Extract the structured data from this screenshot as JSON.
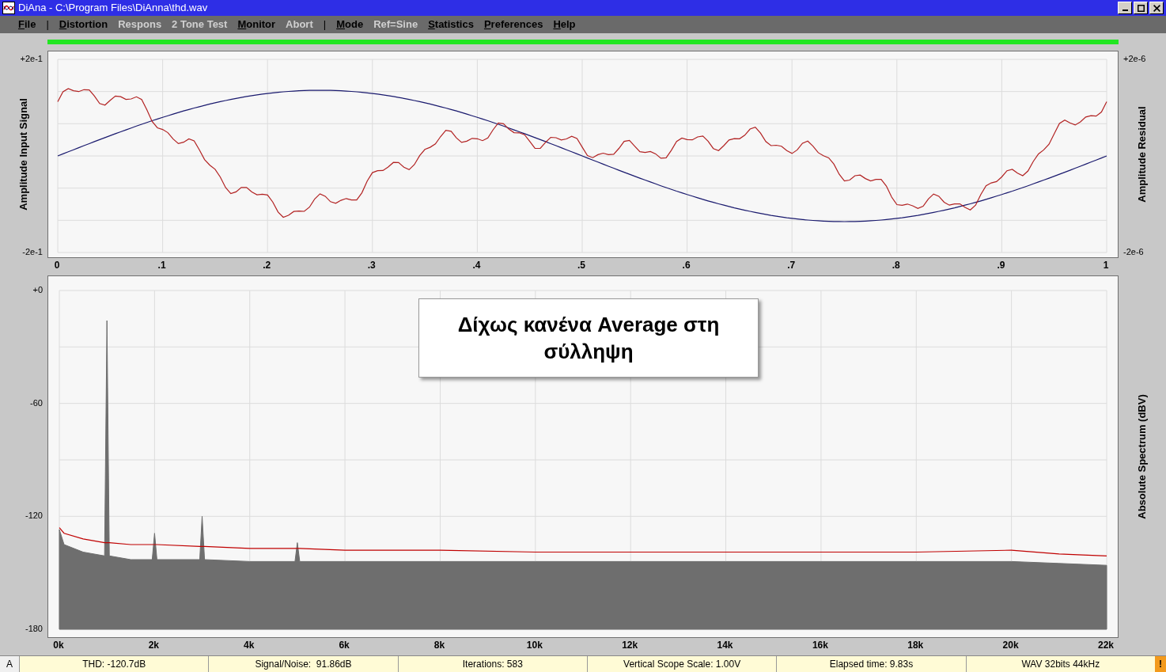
{
  "window": {
    "title": "DiAna - C:\\Program Files\\DiAnna\\thd.wav"
  },
  "menu": [
    {
      "kind": "item",
      "label": "File",
      "disabled": false
    },
    {
      "kind": "separator",
      "label": "|"
    },
    {
      "kind": "item",
      "label": "Distortion",
      "disabled": false
    },
    {
      "kind": "item",
      "label": "Respons",
      "disabled": true
    },
    {
      "kind": "item",
      "label": "2 Tone Test",
      "disabled": true
    },
    {
      "kind": "item",
      "label": "Monitor",
      "disabled": false
    },
    {
      "kind": "item",
      "label": "Abort",
      "disabled": true
    },
    {
      "kind": "separator",
      "label": "|"
    },
    {
      "kind": "item",
      "label": "Mode",
      "disabled": false
    },
    {
      "kind": "item",
      "label": "Ref=Sine",
      "disabled": true
    },
    {
      "kind": "item",
      "label": "Statistics",
      "disabled": false
    },
    {
      "kind": "item",
      "label": "Preferences",
      "disabled": false
    },
    {
      "kind": "item",
      "label": "Help",
      "disabled": false
    }
  ],
  "scope": {
    "ylabel": "Amplitude Input Signal",
    "ytick_labels": [
      "+2e-1",
      "-2e-1"
    ],
    "y2label": "Amplitude Residual",
    "y2tick_labels": [
      "+2e-6",
      "-2e-6"
    ],
    "xtick_labels": [
      "0",
      ".1",
      ".2",
      ".3",
      ".4",
      ".5",
      ".6",
      ".7",
      ".8",
      ".9",
      "1"
    ]
  },
  "spectrum": {
    "note": "Δίχως κανένα Average στη σύλληψη",
    "chart_data": {
      "type": "area",
      "ylabel": "Absolute Spectrum (dBV)",
      "grid": true,
      "xlim": [
        0,
        22
      ],
      "ylim": [
        -180,
        0
      ],
      "xticks": [
        {
          "value": 0,
          "label": "0k"
        },
        {
          "value": 2,
          "label": "2k"
        },
        {
          "value": 4,
          "label": "4k"
        },
        {
          "value": 6,
          "label": "6k"
        },
        {
          "value": 8,
          "label": "8k"
        },
        {
          "value": 10,
          "label": "10k"
        },
        {
          "value": 12,
          "label": "12k"
        },
        {
          "value": 14,
          "label": "14k"
        },
        {
          "value": 16,
          "label": "16k"
        },
        {
          "value": 18,
          "label": "18k"
        },
        {
          "value": 20,
          "label": "20k"
        },
        {
          "value": 22,
          "label": "22k"
        }
      ],
      "yticks": [
        {
          "value": 0,
          "label": "+0"
        },
        {
          "value": -60,
          "label": "-60"
        },
        {
          "value": -120,
          "label": "-120"
        },
        {
          "value": -180,
          "label": "-180"
        }
      ],
      "x": [
        0,
        0,
        0.1,
        0.5,
        0.95,
        1,
        1.05,
        1.5,
        1.95,
        2,
        2.05,
        2.95,
        3,
        3.05,
        4,
        4.95,
        5,
        5.05,
        6,
        8,
        10,
        12,
        14,
        16,
        18,
        20,
        21,
        22,
        22
      ],
      "series": [
        {
          "type": "area",
          "color": "#6e6e6e",
          "values": [
            -180,
            -127,
            -135,
            -139,
            -141,
            -16,
            -141,
            -143,
            -143,
            -129,
            -143,
            -143,
            -120,
            -143,
            -144,
            -144,
            -134,
            -144,
            -144,
            -144,
            -144,
            -144,
            -144,
            -144,
            -144,
            -144,
            -145,
            -146,
            -180
          ]
        },
        {
          "type": "line",
          "color": "#c00000",
          "values": [
            null,
            -126,
            -129,
            -132,
            -134,
            -134,
            -134,
            -135,
            -135,
            -135,
            -135,
            -136,
            -136,
            -136,
            -137,
            -137,
            -137,
            -137,
            -138,
            -138,
            -139,
            -139,
            -139,
            -139,
            -139,
            -138,
            -140,
            -141,
            null
          ]
        }
      ]
    }
  },
  "status_bar": {
    "mode": "A",
    "cells": [
      "THD: -120.7dB",
      "Signal/Noise:  91.86dB",
      "Iterations: 583",
      "Vertical Scope Scale: 1.00V",
      "Elapsed time: 9.83s",
      "WAV 32bits 44kHz"
    ],
    "alert": "!"
  }
}
